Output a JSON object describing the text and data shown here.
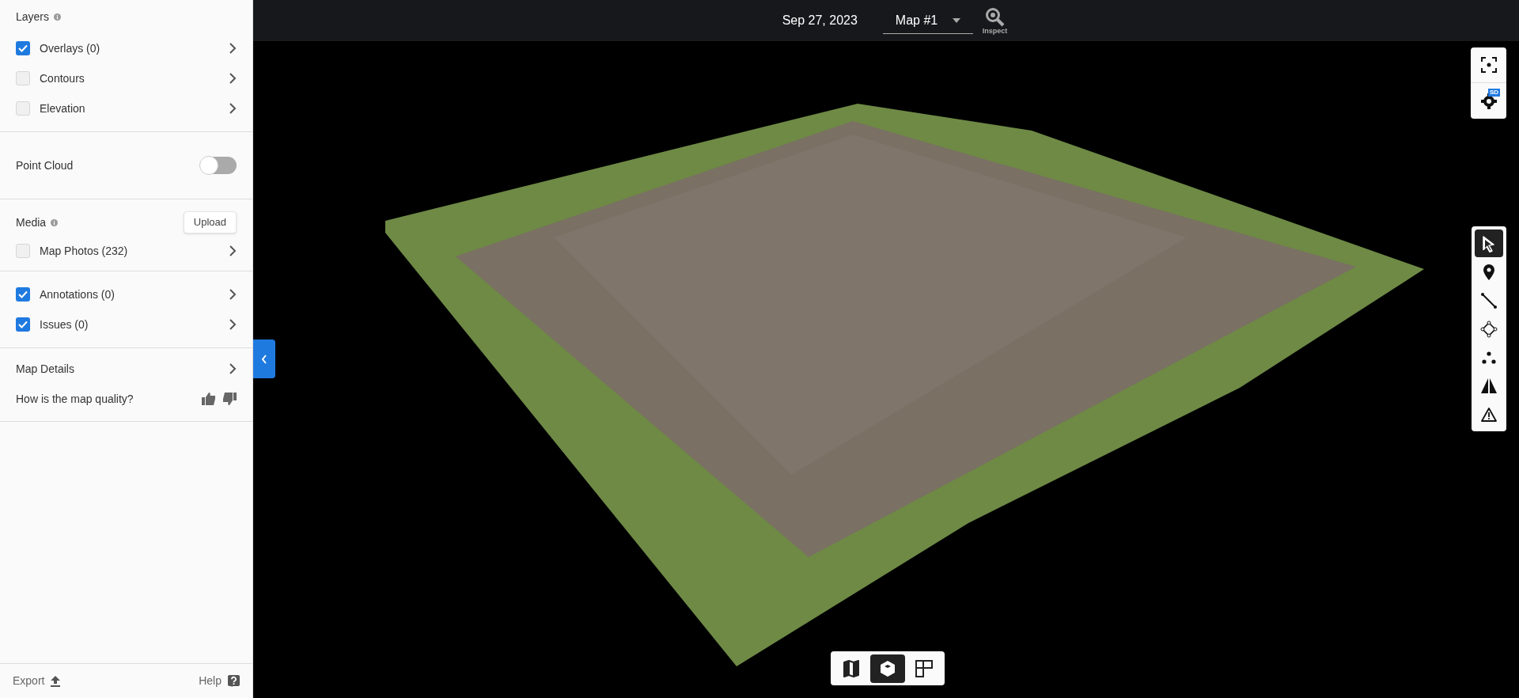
{
  "sidebar": {
    "layers": {
      "title": "Layers",
      "items": [
        {
          "label": "Overlays (0)",
          "checked": true
        },
        {
          "label": "Contours",
          "checked": false
        },
        {
          "label": "Elevation",
          "checked": false
        }
      ]
    },
    "point_cloud": {
      "label": "Point Cloud",
      "on": false
    },
    "media": {
      "title": "Media",
      "upload_button": "Upload",
      "items": [
        {
          "label": "Map Photos (232)",
          "checked": false
        }
      ]
    },
    "markup": {
      "items": [
        {
          "label": "Annotations (0)",
          "checked": true
        },
        {
          "label": "Issues (0)",
          "checked": true
        }
      ]
    },
    "map_details": "Map Details",
    "quality_question": "How is the map quality?",
    "footer": {
      "export": "Export",
      "help": "Help"
    }
  },
  "topbar": {
    "date": "Sep 27, 2023",
    "map_select": "Map #1",
    "inspect": "Inspect"
  },
  "view_settings": {
    "badge": "SD"
  },
  "tools": [
    {
      "kind": "select",
      "selected": true
    },
    {
      "kind": "pin",
      "selected": false
    },
    {
      "kind": "line",
      "selected": false
    },
    {
      "kind": "polygon",
      "selected": false
    },
    {
      "kind": "points",
      "selected": false
    },
    {
      "kind": "volume",
      "selected": false
    },
    {
      "kind": "issue",
      "selected": false
    }
  ],
  "view_modes": [
    {
      "kind": "map",
      "selected": false
    },
    {
      "kind": "model",
      "selected": true
    },
    {
      "kind": "split",
      "selected": false
    }
  ]
}
